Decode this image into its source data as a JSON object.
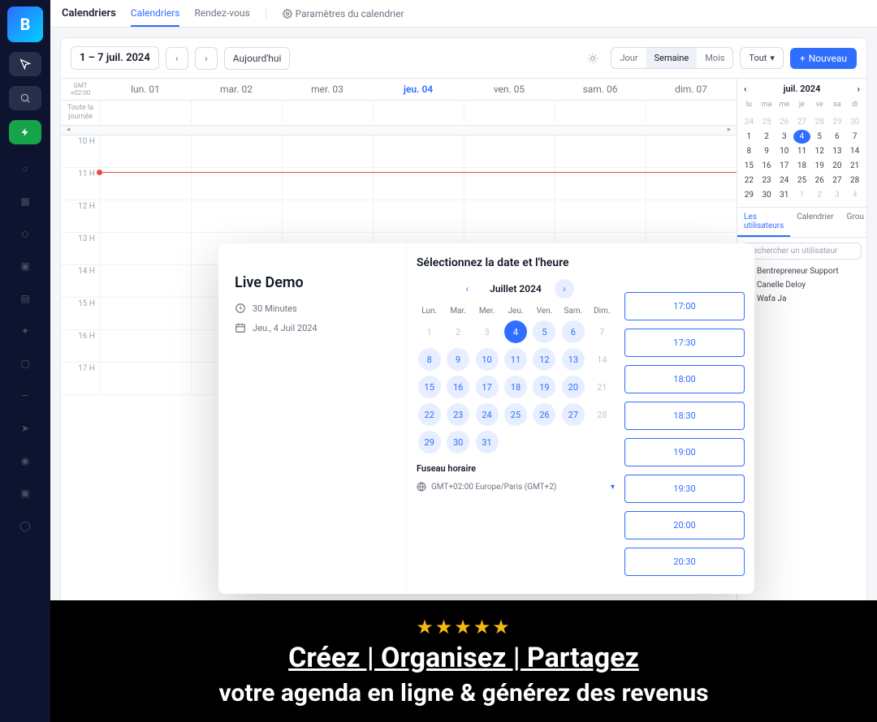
{
  "logo": "B",
  "topbar": {
    "title": "Calendriers",
    "tab_calendars": "Calendriers",
    "tab_appointments": "Rendez-vous",
    "settings_link": "Paramètres du calendrier"
  },
  "toolbar": {
    "date_range": "1 – 7 juil. 2024",
    "today": "Aujourd'hui",
    "view_day": "Jour",
    "view_week": "Semaine",
    "view_month": "Mois",
    "filter_all": "Tout",
    "new": "Nouveau"
  },
  "week": {
    "gmt": "GMT +02:00",
    "days": [
      "lun. 01",
      "mar. 02",
      "mer. 03",
      "jeu. 04",
      "ven. 05",
      "sam. 06",
      "dim. 07"
    ],
    "today_index": 3,
    "allday": "Toute la journée",
    "hours": [
      "10 H",
      "11 H",
      "12 H",
      "13 H",
      "14 H",
      "15 H",
      "16 H",
      "17 H"
    ]
  },
  "mini": {
    "month": "juil. 2024",
    "dow": [
      "lu",
      "ma",
      "me",
      "je",
      "ve",
      "sa",
      "di"
    ],
    "rows": [
      [
        {
          "n": 24,
          "dim": true
        },
        {
          "n": 25,
          "dim": true
        },
        {
          "n": 26,
          "dim": true
        },
        {
          "n": 27,
          "dim": true
        },
        {
          "n": 28,
          "dim": true
        },
        {
          "n": 29,
          "dim": true
        },
        {
          "n": 30,
          "dim": true
        }
      ],
      [
        {
          "n": 1
        },
        {
          "n": 2
        },
        {
          "n": 3
        },
        {
          "n": 4,
          "sel": true
        },
        {
          "n": 5
        },
        {
          "n": 6
        },
        {
          "n": 7
        }
      ],
      [
        {
          "n": 8
        },
        {
          "n": 9
        },
        {
          "n": 10
        },
        {
          "n": 11
        },
        {
          "n": 12
        },
        {
          "n": 13
        },
        {
          "n": 14
        }
      ],
      [
        {
          "n": 15
        },
        {
          "n": 16
        },
        {
          "n": 17
        },
        {
          "n": 18
        },
        {
          "n": 19
        },
        {
          "n": 20
        },
        {
          "n": 21
        }
      ],
      [
        {
          "n": 22
        },
        {
          "n": 23
        },
        {
          "n": 24
        },
        {
          "n": 25
        },
        {
          "n": 26
        },
        {
          "n": 27
        },
        {
          "n": 28
        }
      ],
      [
        {
          "n": 29
        },
        {
          "n": 30
        },
        {
          "n": 31
        },
        {
          "n": 1,
          "dim": true
        },
        {
          "n": 2,
          "dim": true
        },
        {
          "n": 3,
          "dim": true
        },
        {
          "n": 4,
          "dim": true
        }
      ]
    ],
    "tab_users": "Les utilisateurs",
    "tab_calendar": "Calendrier",
    "tab_groups": "Grou",
    "search_placeholder": "Rechercher un utilisateur",
    "users": [
      {
        "name": "Bentrepreneur Support",
        "checked": false
      },
      {
        "name": "Canelle Deloy",
        "checked": false
      },
      {
        "name": "Wafa Ja",
        "checked": true
      }
    ]
  },
  "modal": {
    "title": "Live Demo",
    "duration": "30 Minutes",
    "date": "Jeu., 4 Juil 2024",
    "heading": "Sélectionnez la date et l'heure",
    "month": "Juillet 2024",
    "dow": [
      "Lun.",
      "Mar.",
      "Mer.",
      "Jeu.",
      "Ven.",
      "Sam.",
      "Dim."
    ],
    "picker_rows": [
      [
        {
          "n": 1,
          "dim": true
        },
        {
          "n": 2,
          "dim": true
        },
        {
          "n": 3,
          "dim": true
        },
        {
          "n": 4,
          "sel": true
        },
        {
          "n": 5,
          "avail": true
        },
        {
          "n": 6,
          "avail": true
        },
        {
          "n": 7,
          "dim": true
        }
      ],
      [
        {
          "n": 8,
          "avail": true
        },
        {
          "n": 9,
          "avail": true
        },
        {
          "n": 10,
          "avail": true
        },
        {
          "n": 11,
          "avail": true
        },
        {
          "n": 12,
          "avail": true
        },
        {
          "n": 13,
          "avail": true
        },
        {
          "n": 14,
          "dim": true
        }
      ],
      [
        {
          "n": 15,
          "avail": true
        },
        {
          "n": 16,
          "avail": true
        },
        {
          "n": 17,
          "avail": true
        },
        {
          "n": 18,
          "avail": true
        },
        {
          "n": 19,
          "avail": true
        },
        {
          "n": 20,
          "avail": true
        },
        {
          "n": 21,
          "dim": true
        }
      ],
      [
        {
          "n": 22,
          "avail": true
        },
        {
          "n": 23,
          "avail": true
        },
        {
          "n": 24,
          "avail": true
        },
        {
          "n": 25,
          "avail": true
        },
        {
          "n": 26,
          "avail": true
        },
        {
          "n": 27,
          "avail": true
        },
        {
          "n": 28,
          "dim": true
        }
      ],
      [
        {
          "n": 29,
          "avail": true
        },
        {
          "n": 30,
          "avail": true
        },
        {
          "n": 31,
          "avail": true
        },
        {},
        {},
        {},
        {}
      ]
    ],
    "tz_label": "Fuseau horaire",
    "tz_value": "GMT+02:00 Europe/Paris (GMT+2)",
    "slots": [
      "17:00",
      "17:30",
      "18:00",
      "18:30",
      "19:00",
      "19:30",
      "20:00",
      "20:30"
    ]
  },
  "promo": {
    "stars": "★★★★★",
    "headline": "Créez | Organisez | Partagez",
    "sub": "votre agenda en ligne & générez des revenus"
  }
}
